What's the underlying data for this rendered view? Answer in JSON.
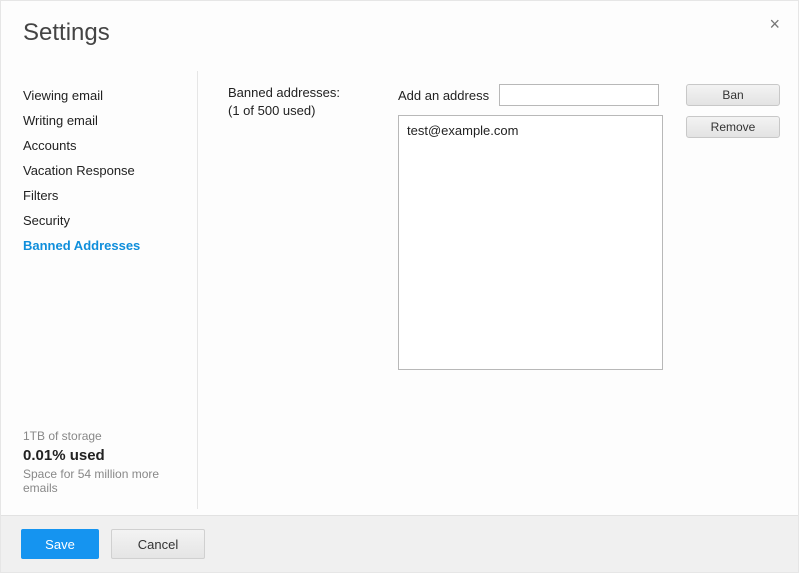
{
  "header": {
    "title": "Settings"
  },
  "close_glyph": "×",
  "sidebar": {
    "items": [
      {
        "label": "Viewing email",
        "active": false
      },
      {
        "label": "Writing email",
        "active": false
      },
      {
        "label": "Accounts",
        "active": false
      },
      {
        "label": "Vacation Response",
        "active": false
      },
      {
        "label": "Filters",
        "active": false
      },
      {
        "label": "Security",
        "active": false
      },
      {
        "label": "Banned Addresses",
        "active": true
      }
    ],
    "storage": {
      "capacity": "1TB of storage",
      "used_pct": "0.01% used",
      "remaining": "Space for 54 million more emails"
    }
  },
  "main": {
    "section_label": "Banned addresses:",
    "section_sub": "(1 of 500 used)",
    "add_label": "Add an address",
    "add_value": "",
    "add_placeholder": "",
    "ban_button": "Ban",
    "remove_button": "Remove",
    "banned_list": [
      "test@example.com"
    ]
  },
  "footer": {
    "save": "Save",
    "cancel": "Cancel"
  }
}
